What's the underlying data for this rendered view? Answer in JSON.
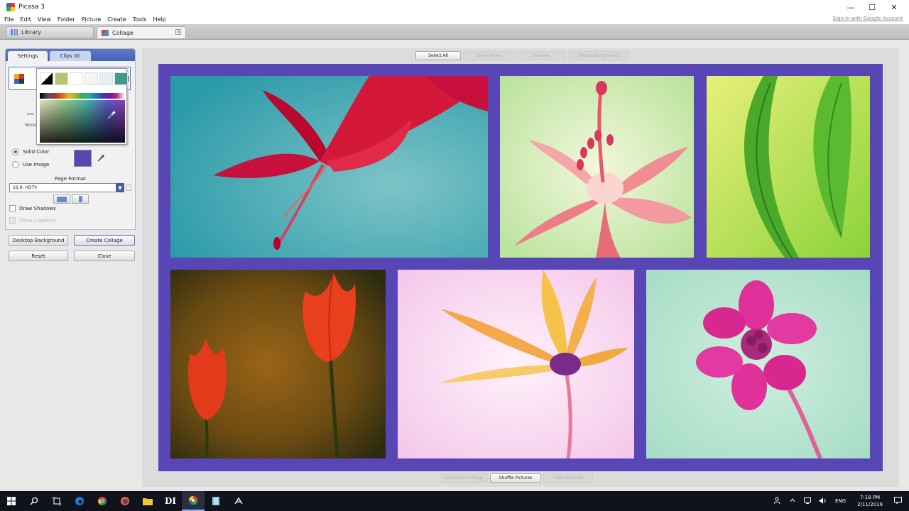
{
  "window": {
    "title": "Picasa 3",
    "minimize": "—",
    "maximize": "☐",
    "close": "✕"
  },
  "menu": [
    "File",
    "Edit",
    "View",
    "Folder",
    "Picture",
    "Create",
    "Tools",
    "Help"
  ],
  "account": {
    "signin": "Sign in with Google Account"
  },
  "tabs": {
    "library": "Library",
    "collage": "Collage",
    "close": "×"
  },
  "panel": {
    "tabs": {
      "settings": "Settings",
      "clips": "Clips (0)"
    },
    "none_label": "None",
    "background": {
      "solid_color": "Solid Color",
      "use_image": "Use Image",
      "color": "#5746b3"
    },
    "page_format": {
      "label": "Page Format",
      "value": "16:9: HDTV"
    },
    "options": {
      "draw_shadows": "Draw Shadows",
      "show_captions": "Show Captions"
    },
    "buttons": {
      "desktop_background": "Desktop Background",
      "create_collage": "Create Collage",
      "reset": "Reset",
      "close": "Close"
    }
  },
  "toolbar": {
    "select_all": "Select All",
    "select_none": "Select None",
    "remove": "Remove",
    "set_as_background": "Set as Background"
  },
  "bottom": {
    "scramble": "Scramble Collage",
    "shuffle": "Shuffle Pictures",
    "view_edit": "View and Edit"
  },
  "picker": {
    "presets": [
      "#000000",
      "#b8c474",
      "#ffffff",
      "#f4f4f4",
      "#e8eef4",
      "#3f9b8e"
    ]
  },
  "colors": {
    "canvas": "#5746b3",
    "accent": "#4862b8"
  },
  "taskbar": {
    "apps": [
      "windows-start-icon",
      "search-icon",
      "task-view-icon",
      "edge-icon",
      "chrome-icon",
      "firefox-icon",
      "file-explorer-icon",
      "di-app-icon",
      "picasa-icon",
      "notepad-icon",
      "app-icon"
    ],
    "di_label": "DI",
    "lang": "ENG",
    "time": "7:18 PM",
    "date": "2/11/2019"
  }
}
